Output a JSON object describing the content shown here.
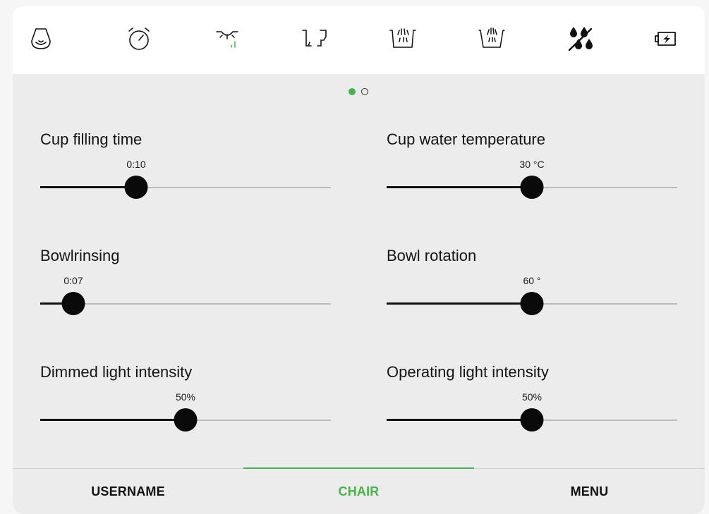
{
  "toolbar": {
    "icons": [
      "spittoon-icon",
      "timer-icon",
      "dimmed-light-icon",
      "chair-position-icon",
      "bowl-rinse-hot-icon",
      "bowl-rinse-icon",
      "no-water-icon",
      "battery-charging-icon"
    ]
  },
  "pagination": {
    "current_page": 1,
    "total_pages": 2
  },
  "settings": {
    "cup_filling_time": {
      "label": "Cup filling time",
      "value_text": "0:10",
      "position": 0.33
    },
    "cup_water_temperature": {
      "label": "Cup water temperature",
      "value_text": "30 °C",
      "position": 0.5
    },
    "bowlrinsing": {
      "label": "Bowlrinsing",
      "value_text": "0:07",
      "position": 0.115
    },
    "bowl_rotation": {
      "label": "Bowl rotation",
      "value_text": "60 °",
      "position": 0.5
    },
    "dimmed_light_intensity": {
      "label": "Dimmed light intensity",
      "value_text": "50%",
      "position": 0.5
    },
    "operating_light_intensity": {
      "label": "Operating light intensity",
      "value_text": "50%",
      "position": 0.5
    }
  },
  "bottom_nav": {
    "username": "USERNAME",
    "chair": "CHAIR",
    "menu": "MENU",
    "active": "chair"
  },
  "colors": {
    "accent": "#45b549",
    "panel": "#ebeceb",
    "toolbar": "#ffffff",
    "thumb": "#0a0a0a"
  }
}
